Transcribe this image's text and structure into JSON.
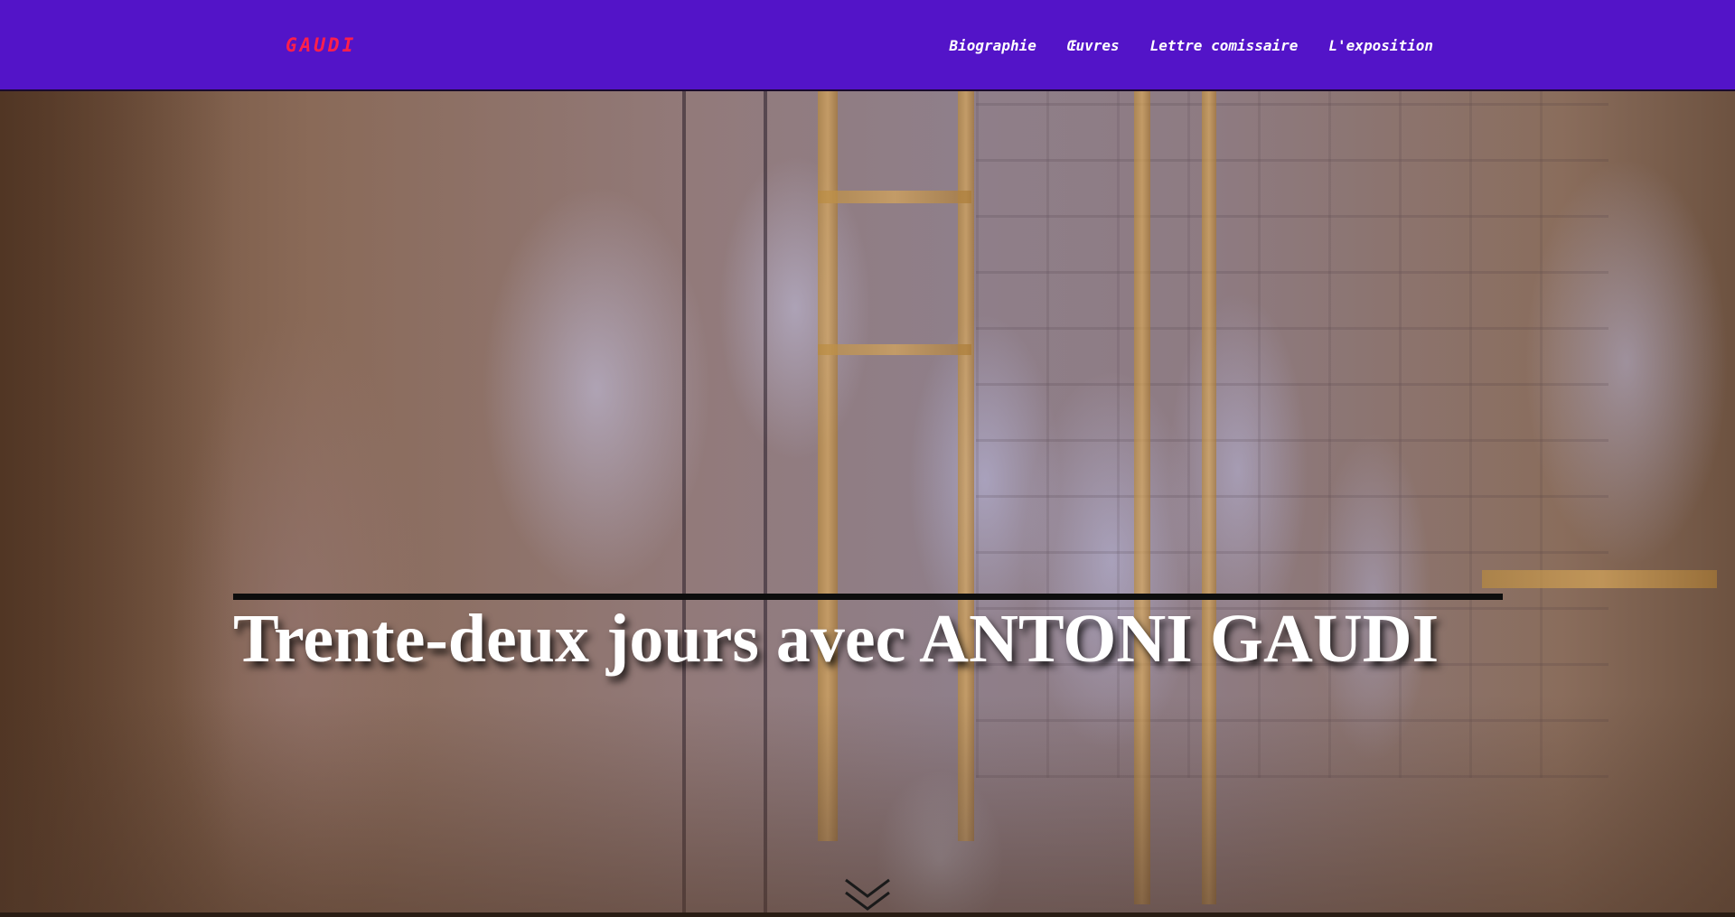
{
  "brand": {
    "logo_text": "GAUDI",
    "logo_color": "#ff1f4b"
  },
  "nav": {
    "background_color": "#5314c8",
    "items": [
      {
        "label": "Biographie"
      },
      {
        "label": "Œuvres"
      },
      {
        "label": "Lettre comissaire"
      },
      {
        "label": "L'exposition"
      }
    ]
  },
  "hero": {
    "title": "Trente-deux jours avec ANTONI GAUDI",
    "background_description_icon": "sculpture-workshop-photo",
    "scroll_icon": "chevron-down-icon"
  }
}
